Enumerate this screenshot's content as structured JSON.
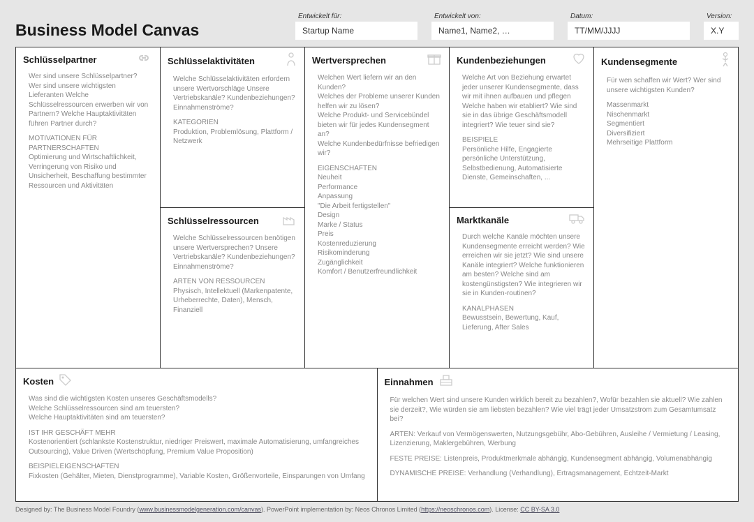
{
  "header": {
    "title": "Business Model Canvas",
    "meta": {
      "for_label": "Entwickelt für:",
      "for_value": "Startup Name",
      "by_label": "Entwickelt von:",
      "by_value": "Name1, Name2, …",
      "date_label": "Datum:",
      "date_value": "TT/MM/JJJJ",
      "version_label": "Version:",
      "version_value": "X.Y"
    }
  },
  "blocks": {
    "partners": {
      "title": "Schlüsselpartner",
      "q": "Wer sind unsere Schlüsselpartner? Wer sind unsere wichtigsten Lieferanten Welche Schlüsselressourcen erwerben wir von Partnern? Welche Hauptaktivitäten führen Partner durch?",
      "sub": "MOTIVATIONEN FÜR PARTNERSCHAFTEN\nOptimierung und Wirtschaftlichkeit, Verringerung von Risiko und Unsicherheit, Beschaffung bestimmter Ressourcen und Aktivitäten"
    },
    "activities": {
      "title": "Schlüsselaktivitäten",
      "q": "Welche Schlüsselaktivitäten erfordern unsere Wertvorschläge Unsere Vertriebskanäle? Kundenbeziehungen? Einnahmenströme?",
      "sub": "KATEGORIEN\nProduktion, Problemlösung, Plattform / Netzwerk"
    },
    "resources": {
      "title": "Schlüsselressourcen",
      "q": "Welche Schlüsselressourcen benötigen unsere Wertversprechen? Unsere Vertriebskanäle? Kundenbeziehungen? Einnahmenströme?",
      "sub": "ARTEN VON RESSOURCEN\nPhysisch, Intellektuell (Markenpatente, Urheberrechte, Daten), Mensch, Finanziell"
    },
    "value": {
      "title": "Wertversprechen",
      "q": "Welchen Wert liefern wir an den Kunden?\nWelches der Probleme unserer Kunden helfen wir zu lösen?\nWelche Produkt- und Servicebündel bieten wir für jedes Kundensegment an?\nWelche Kundenbedürfnisse befriedigen wir?",
      "sub": "EIGENSCHAFTEN\nNeuheit\nPerformance\nAnpassung\n\"Die Arbeit fertigstellen\"\nDesign\nMarke / Status\nPreis\nKostenreduzierung\nRisikominderung\nZugänglichkeit\nKomfort / Benutzerfreundlichkeit"
    },
    "relationships": {
      "title": "Kundenbeziehungen",
      "q": "Welche Art von Beziehung erwartet jeder unserer Kundensegmente, dass wir mit ihnen aufbauen und pflegen Welche haben wir etabliert? Wie sind sie in das übrige Geschäftsmodell integriert? Wie teuer sind sie?",
      "sub": "BEISPIELE\nPersönliche Hilfe, Engagierte persönliche Unterstützung, Selbstbedienung, Automatisierte Dienste, Gemeinschaften, ..."
    },
    "channels": {
      "title": "Marktkanäle",
      "q": "Durch welche Kanäle möchten unsere Kundensegmente erreicht werden? Wie erreichen wir sie jetzt? Wie sind unsere Kanäle integriert? Welche funktionieren am besten? Welche sind am kostengünstigsten? Wie integrieren wir sie in Kunden-routinen?",
      "sub": "KANALPHASEN\nBewusstsein, Bewertung, Kauf, Lieferung, After Sales"
    },
    "segments": {
      "title": "Kundensegmente",
      "q": "Für wen schaffen wir Wert? Wer sind unsere wichtigsten Kunden?",
      "sub": "Massenmarkt\nNischenmarkt\nSegmentiert\nDiversifiziert\nMehrseitige Plattform"
    },
    "costs": {
      "title": "Kosten",
      "q": "Was sind die wichtigsten Kosten unseres Geschäftsmodells?\nWelche Schlüsselressourcen sind am teuersten?\nWelche Hauptaktivitäten sind am teuersten?",
      "sub1": "IST IHR GESCHÄFT MEHR\nKostenorientiert (schlankste Kostenstruktur, niedriger Preiswert, maximale Automatisierung, umfangreiches Outsourcing), Value Driven (Wertschöpfung, Premium Value Proposition)",
      "sub2": "BEISPIELEIGENSCHAFTEN\nFixkosten (Gehälter, Mieten, Dienstprogramme), Variable Kosten, Größenvorteile, Einsparungen von Umfang"
    },
    "revenue": {
      "title": "Einnahmen",
      "q": "Für welchen Wert sind unsere Kunden wirklich bereit zu bezahlen?, Wofür bezahlen sie aktuell? Wie zahlen sie derzeit?, Wie würden sie am liebsten bezahlen? Wie viel trägt jeder Umsatzstrom zum Gesamtumsatz bei?",
      "sub1": "ARTEN: Verkauf von Vermögenswerten, Nutzungsgebühr, Abo-Gebühren, Ausleihe / Vermietung / Leasing, Lizenzierung, Maklergebühren, Werbung",
      "sub2": "FESTE PREISE: Listenpreis, Produktmerkmale abhängig, Kundensegment abhängig, Volumenabhängig",
      "sub3": "DYNAMISCHE PREISE: Verhandlung (Verhandlung), Ertragsmanagement, Echtzeit-Markt"
    }
  },
  "footer": {
    "prefix": "Designed by: The Business Model Foundry (",
    "link1_text": "www.businessmodelgeneration.com/canvas",
    "mid": "). PowerPoint implementation by: Neos Chronos Limited (",
    "link2_text": "https://neoschronos.com",
    "suffix": "). License: ",
    "link3_text": "CC BY-SA 3.0"
  }
}
